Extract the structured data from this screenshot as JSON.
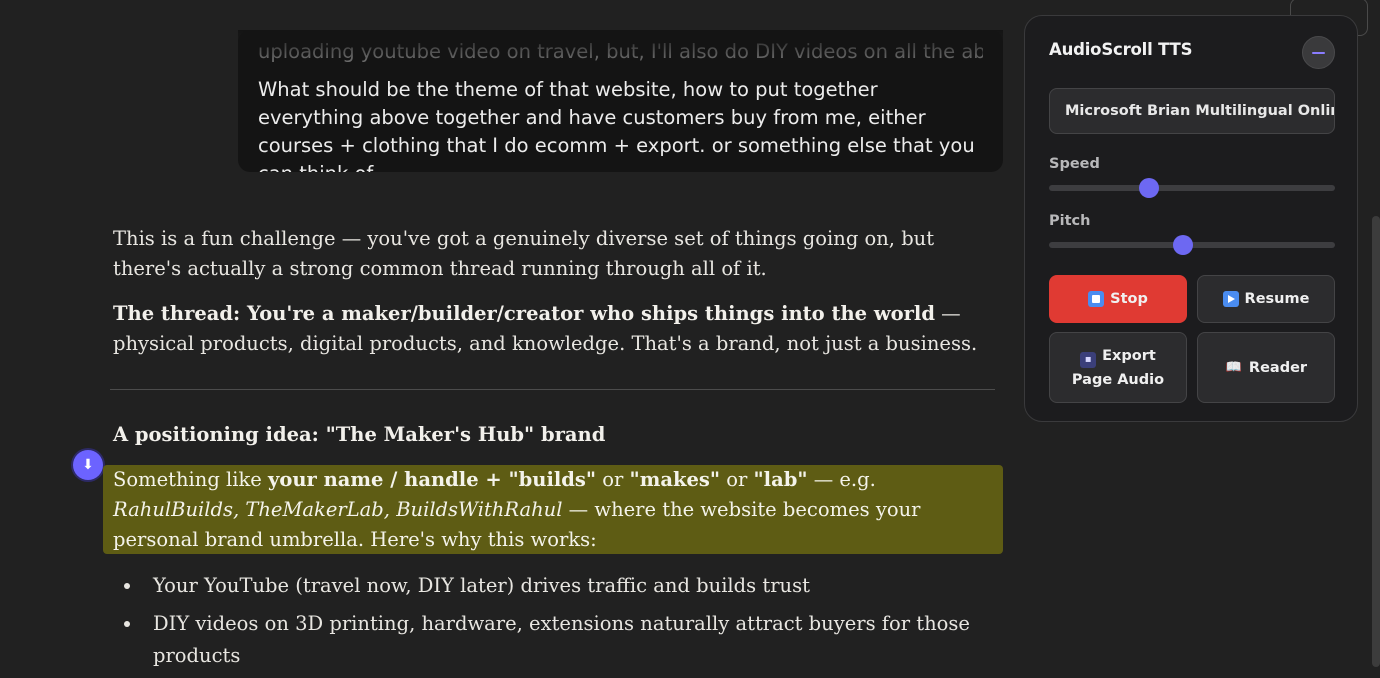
{
  "chat": {
    "user_message_faded": "uploading youtube video on travel, but, I'll also do DIY videos on all the above.",
    "user_message": "What should be the theme of that website, how to put together everything above together and have customers buy from me, either courses + clothing that I do ecomm + export. or something else that you can think of",
    "intro": "This is a fun challenge — you've got a genuinely diverse set of things going on, but there's actually a strong common thread running through all of it.",
    "thread_bold": "The thread: You're a maker/builder/creator who ships things into the world",
    "thread_rest": " — physical products, digital products, and knowledge. That's a brand, not just a business.",
    "heading": "A positioning idea: \"The Maker's Hub\" brand",
    "hl_1": "Something like ",
    "hl_2": "your name / handle + \"builds\"",
    "hl_3": " or ",
    "hl_4": "\"makes\"",
    "hl_5": " or ",
    "hl_6": "\"lab\"",
    "hl_7": " — e.g. ",
    "hl_8": "RahulBuilds, TheMakerLab, BuildsWithRahul",
    "hl_9": " — where the website becomes your personal brand umbrella. Here's why this works:",
    "bullets": [
      "Your YouTube (travel now, DIY later) drives traffic and builds trust",
      "DIY videos on 3D printing, hardware, extensions naturally attract buyers for those products"
    ]
  },
  "tts_panel": {
    "title": "AudioScroll TTS",
    "voice": "Microsoft Brian Multilingual Online (Natural) - English (United States)",
    "speed_label": "Speed",
    "speed_value": 0.35,
    "pitch_label": "Pitch",
    "pitch_value": 0.47,
    "stop_label": "Stop",
    "resume_label": "Resume",
    "export_label": "Export Page Audio",
    "reader_label": "Reader",
    "accent_color": "#6d68f2",
    "stop_color": "#e03a33"
  }
}
